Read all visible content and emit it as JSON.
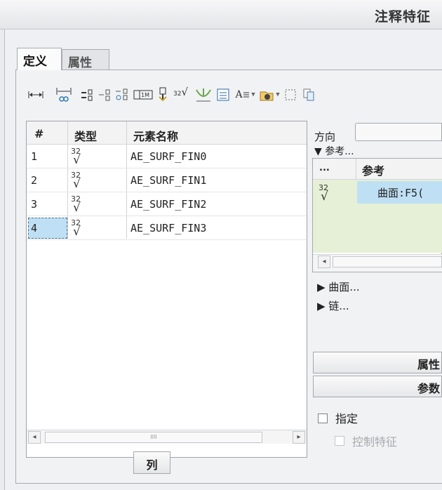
{
  "window": {
    "title": "注释特征"
  },
  "tabs": [
    {
      "label": "定义",
      "active": true
    },
    {
      "label": "属性",
      "active": false
    }
  ],
  "toolbar": {
    "icons": [
      "dimension-icon",
      "ref-dimension-icon",
      "gtol-icon",
      "datum-icon",
      "datum-target-icon",
      "note-icon",
      "symbol-icon",
      "surface-finish-icon",
      "weld-icon",
      "table-icon",
      "text-style-icon",
      "dropdown-arrow-icon",
      "annotation-plane-icon",
      "dropdown-arrow-icon",
      "select-box-icon",
      "copy-icon"
    ],
    "text_style_glyph": "A",
    "surface_finish_glyph": "³²√"
  },
  "element_list": {
    "columns": [
      "#",
      "类型",
      "元素名称"
    ],
    "rows": [
      {
        "num": "1",
        "type_symbol_top": "32",
        "type_symbol": "√",
        "name": "AE_SURF_FIN0",
        "selected": false
      },
      {
        "num": "2",
        "type_symbol_top": "32",
        "type_symbol": "√",
        "name": "AE_SURF_FIN1",
        "selected": false
      },
      {
        "num": "3",
        "type_symbol_top": "32",
        "type_symbol": "√",
        "name": "AE_SURF_FIN2",
        "selected": false
      },
      {
        "num": "4",
        "type_symbol_top": "32",
        "type_symbol": "√",
        "name": "AE_SURF_FIN3",
        "selected": true
      }
    ],
    "scroll_thumb_grip": "IIII",
    "columns_button": "列"
  },
  "right_panel": {
    "direction_label": "方向",
    "references_toggle": "▼ 参考...",
    "ref_table": {
      "columns": [
        "...",
        "参考"
      ],
      "rows": [
        {
          "type_symbol_top": "32",
          "type_symbol": "√",
          "reference": "曲面:F5("
        }
      ]
    },
    "surfaces_toggle": "▶ 曲面...",
    "chains_toggle": "▶ 链...",
    "properties_button": "属性",
    "parameters_button": "参数",
    "specify_checkbox": {
      "label": "指定",
      "checked": false
    },
    "control_feature_checkbox": {
      "label": "控制特征",
      "checked": false,
      "disabled": true
    }
  },
  "colors": {
    "selection": "#bfe0f4",
    "reference_area": "#e6f0d6",
    "surface_finish_icon": "#6aa84f"
  }
}
